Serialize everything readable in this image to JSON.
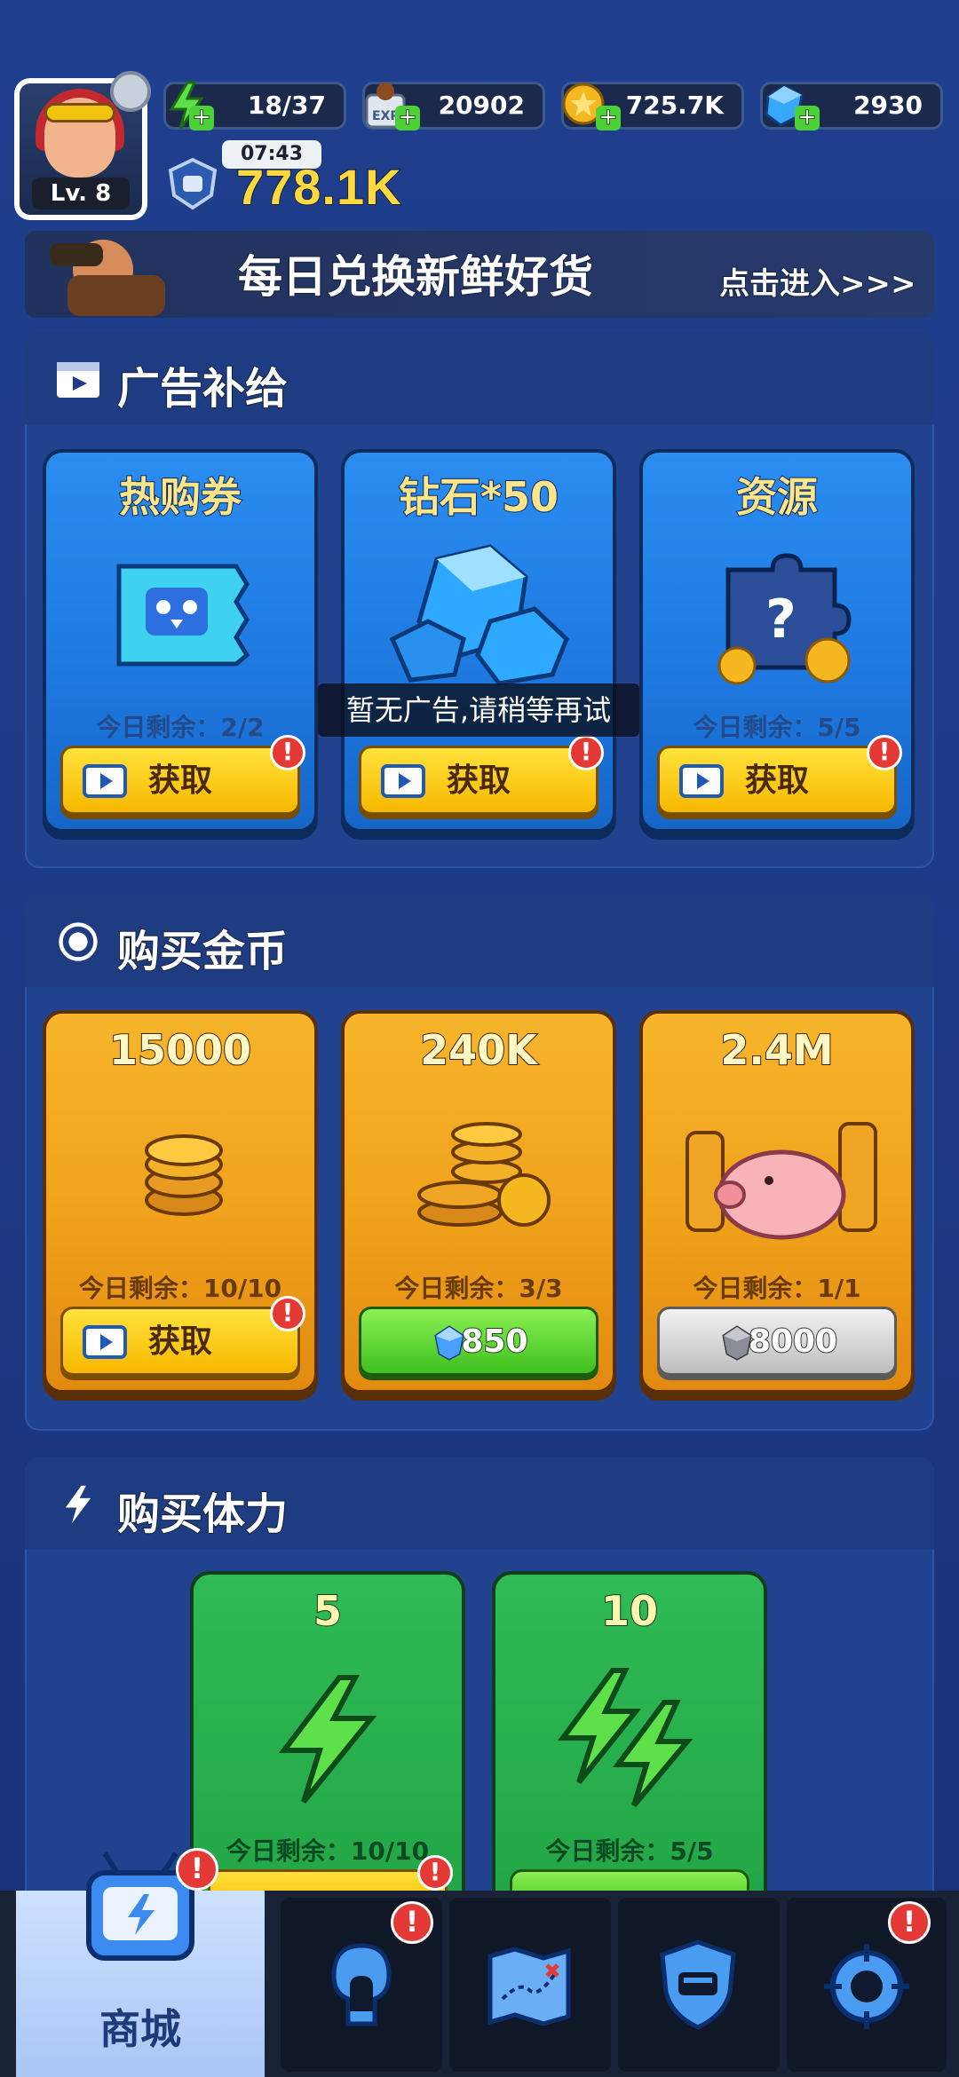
{
  "top": {
    "level": "Lv. 8",
    "energy": "18/37",
    "exp": "20902",
    "coins": "725.7K",
    "gems": "2930",
    "timer": "07:43",
    "power": "778.1K"
  },
  "banner": {
    "title": "每日兑换新鲜好货",
    "link": "点击进入>>>"
  },
  "ads": {
    "title": "广告补给",
    "cards": [
      {
        "title": "热购券",
        "remain": "今日剩余：2/2",
        "button": "获取"
      },
      {
        "title": "钻石*50",
        "remain": "",
        "button": "获取"
      },
      {
        "title": "资源",
        "remain": "今日剩余：5/5",
        "button": "获取"
      }
    ]
  },
  "toast": "暂无广告,请稍等再试",
  "coins_section": {
    "title": "购买金币",
    "cards": [
      {
        "title": "15000",
        "remain": "今日剩余：10/10",
        "button": "获取"
      },
      {
        "title": "240K",
        "remain": "今日剩余：3/3",
        "button": "850"
      },
      {
        "title": "2.4M",
        "remain": "今日剩余：1/1",
        "button": "8000"
      }
    ]
  },
  "stamina_section": {
    "title": "购买体力",
    "cards": [
      {
        "title": "5",
        "remain": "今日剩余：10/10"
      },
      {
        "title": "10",
        "remain": "今日剩余：5/5"
      }
    ]
  },
  "nav": {
    "shop_label": "商城"
  },
  "badge_mark": "!"
}
